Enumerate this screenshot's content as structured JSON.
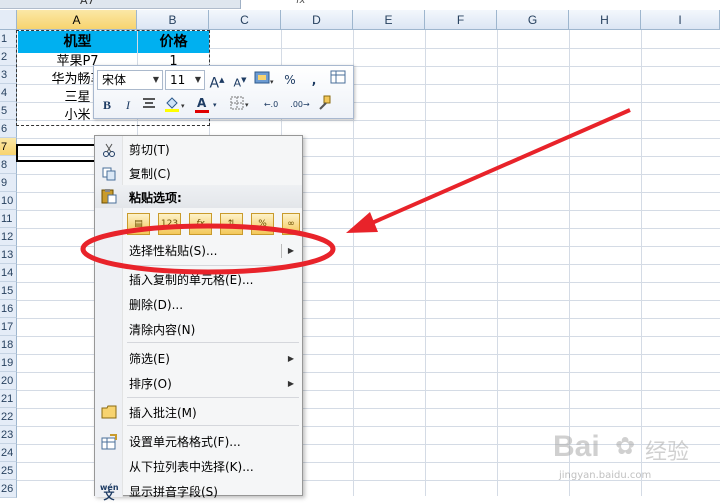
{
  "formula_bar": {
    "name_box": "A7",
    "fx_label": "fx"
  },
  "columns": [
    "A",
    "B",
    "C",
    "D",
    "E",
    "F",
    "G",
    "H",
    "I"
  ],
  "rows": [
    "1",
    "2",
    "3",
    "4",
    "5",
    "6",
    "7",
    "8",
    "9",
    "10",
    "11",
    "12",
    "13",
    "14",
    "15",
    "16",
    "17",
    "18",
    "19",
    "20",
    "21",
    "22",
    "23",
    "24",
    "25",
    "26"
  ],
  "table": {
    "headers": [
      "机型",
      "价格"
    ],
    "models": [
      "苹果P7",
      "华为畅享",
      "三星",
      "小米"
    ],
    "prices": [
      "1",
      "",
      "",
      ""
    ]
  },
  "mini_toolbar": {
    "font_name": "宋体",
    "font_size": "11",
    "grow_font": "A",
    "shrink_font": "A",
    "percent": "%",
    "comma": ",",
    "bold": "B",
    "italic": "I",
    "font_color": "A",
    "dec_increase": ".0",
    "dec_decrease": ".00"
  },
  "context_menu": {
    "cut": "剪切(T)",
    "copy": "复制(C)",
    "paste_options": "粘贴选项:",
    "paste_special": "选择性粘贴(S)...",
    "insert_copied": "插入复制的单元格(E)...",
    "delete": "删除(D)...",
    "clear": "清除内容(N)",
    "filter": "筛选(E)",
    "sort": "排序(O)",
    "insert_comment": "插入批注(M)",
    "format_cells": "设置单元格格式(F)...",
    "pick_from_list": "从下拉列表中选择(K)...",
    "phonetic": "显示拼音字段(S)",
    "phonetic_icon_text": "wén"
  },
  "watermark": {
    "brand": "Bai",
    "brand_cn": "经验",
    "url": "jingyan.baidu.com"
  },
  "colors": {
    "table_header": "#00b0f0",
    "annotation": "#e8232a",
    "selected_header": "#f7d36f"
  }
}
